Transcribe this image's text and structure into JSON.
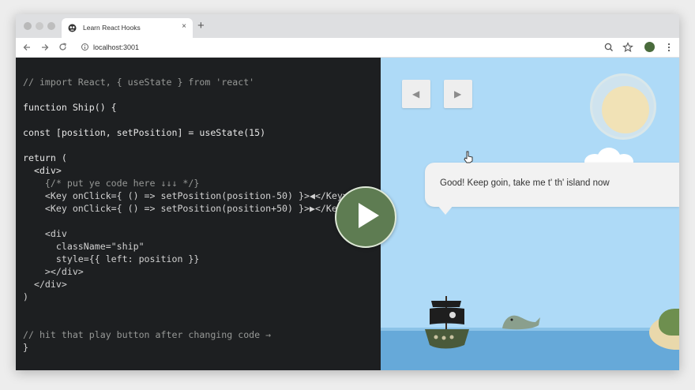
{
  "browser": {
    "tab_title": "Learn React Hooks",
    "tab_close": "×",
    "new_tab": "+",
    "url": "localhost:3001",
    "icons": [
      "back-arrow-icon",
      "forward-arrow-icon",
      "reload-icon",
      "info-icon",
      "zoom-icon",
      "star-icon",
      "profile-avatar",
      "more-menu-icon"
    ]
  },
  "editor": {
    "lines": [
      {
        "cls": "cm",
        "text": "// import React, { useState } from 'react'"
      },
      {
        "cls": "",
        "text": ""
      },
      {
        "cls": "kw",
        "text": "function Ship() {"
      },
      {
        "cls": "",
        "text": ""
      },
      {
        "cls": "kw",
        "text": "const [position, setPosition] = useState(15)"
      },
      {
        "cls": "",
        "text": ""
      },
      {
        "cls": "kw",
        "text": "return ("
      },
      {
        "cls": "kw",
        "text": "  <div>"
      },
      {
        "cls": "cm",
        "text": "    {/* put ye code here ↓↓↓ */}"
      },
      {
        "cls": "",
        "text": "    <Key onClick={ () => setPosition(position-50) }>◀</Key>"
      },
      {
        "cls": "",
        "text": "    <Key onClick={ () => setPosition(position+50) }>▶</Key>"
      },
      {
        "cls": "",
        "text": ""
      },
      {
        "cls": "",
        "text": "    <div"
      },
      {
        "cls": "",
        "text": "      className=\"ship\""
      },
      {
        "cls": "",
        "text": "      style={{ left: position }}"
      },
      {
        "cls": "",
        "text": "    ></div>"
      },
      {
        "cls": "",
        "text": "  </div>"
      },
      {
        "cls": "",
        "text": ")"
      },
      {
        "cls": "",
        "text": ""
      },
      {
        "cls": "",
        "text": ""
      },
      {
        "cls": "cm",
        "text": "// hit that play button after changing code →"
      },
      {
        "cls": "",
        "text": "}"
      }
    ]
  },
  "game": {
    "left_key": "◀",
    "right_key": "▶",
    "speech": "Good! Keep goin, take me t' th' island now"
  },
  "colors": {
    "editor_bg": "#1d1f21",
    "sky": "#aedaf7",
    "sea": "#66a9d9",
    "play_button": "#5e7c52"
  }
}
